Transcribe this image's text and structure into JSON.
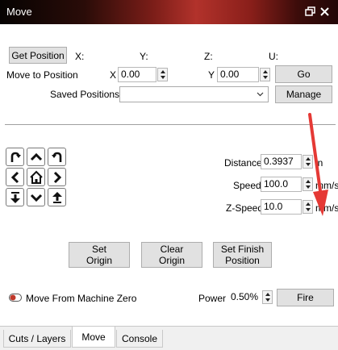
{
  "window": {
    "title": "Move",
    "icons": [
      "restore-icon",
      "close-icon"
    ]
  },
  "position": {
    "get_button": "Get Position",
    "x_label": "X:",
    "y_label": "Y:",
    "z_label": "Z:",
    "u_label": "U:"
  },
  "move_to": {
    "label": "Move to Position",
    "x_label": "X",
    "x_value": "0.00",
    "y_label": "Y",
    "y_value": "0.00",
    "go_button": "Go"
  },
  "saved": {
    "label": "Saved Positions:",
    "selected": "",
    "manage_button": "Manage"
  },
  "jog": {
    "buttons": [
      "rotate-ccw-icon",
      "arrow-up-icon",
      "rotate-cw-icon",
      "arrow-left-icon",
      "home-icon",
      "arrow-right-icon",
      "z-down-icon",
      "arrow-down-icon",
      "z-up-icon"
    ]
  },
  "settings": {
    "distance_label": "Distance",
    "distance_value": "0.3937",
    "distance_unit": "in",
    "speed_label": "Speed",
    "speed_value": "100.0",
    "speed_unit": "mm/s",
    "zspeed_label": "Z-Speed",
    "zspeed_value": "10.0",
    "zspeed_unit": "mm/s"
  },
  "origin": {
    "set_origin": "Set\nOrigin",
    "clear_origin": "Clear\nOrigin",
    "set_finish": "Set Finish\nPosition"
  },
  "bottom": {
    "toggle_label": "Move From Machine Zero",
    "toggle_color": "#c0392b",
    "power_label": "Power",
    "power_value": "0.50%",
    "fire_button": "Fire"
  },
  "annotation": {
    "arrow_color": "#e53935"
  },
  "tabs": [
    {
      "label": "Cuts / Layers",
      "active": false
    },
    {
      "label": "Move",
      "active": true
    },
    {
      "label": "Console",
      "active": false
    }
  ]
}
